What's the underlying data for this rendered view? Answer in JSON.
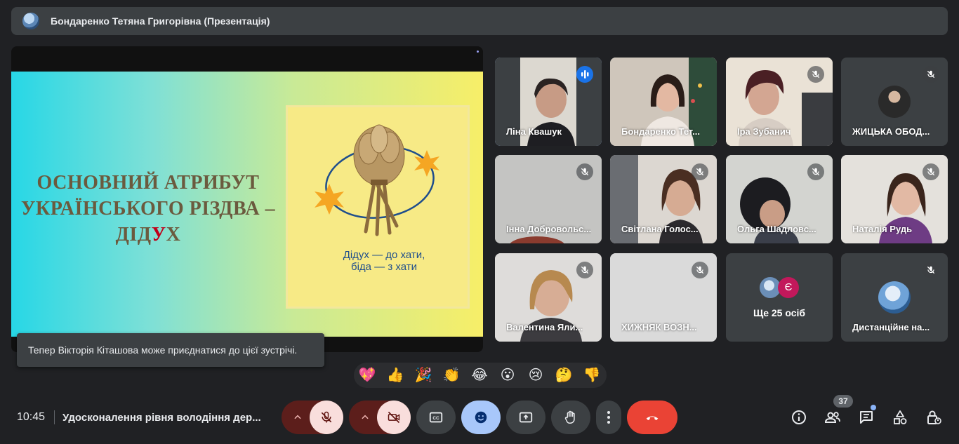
{
  "header": {
    "presenter_title": "Бондаренко Тетяна Григорівна (Презентація)"
  },
  "slide": {
    "heading_line1": "ОСНОВНИЙ АТРИБУТ",
    "heading_line2": "УКРАЇНСЬКОГО РІЗДВА –",
    "heading_line3_a": "ДІД",
    "heading_line3_b": "У",
    "heading_line3_c": "Х",
    "quote_line1": "Дідух — до хати,",
    "quote_line2": "біда — з хати"
  },
  "toast": {
    "message": "Тепер Вікторія Кіташова може приєднатися до цієї зустрічі."
  },
  "participants": [
    {
      "name": "Ліна Квашук",
      "state": "speaking"
    },
    {
      "name": "Бондаренко Тет...",
      "state": "video"
    },
    {
      "name": "Іра Зубанич",
      "state": "muted"
    },
    {
      "name": "ЖИЦЬКА ОБОД...",
      "state": "muted"
    },
    {
      "name": "Інна Добровольс...",
      "state": "muted"
    },
    {
      "name": "Світлана Голос...",
      "state": "muted"
    },
    {
      "name": "Ольга Шадловс...",
      "state": "muted"
    },
    {
      "name": "Наталія Рудь",
      "state": "muted"
    },
    {
      "name": "Валентина Яли...",
      "state": "muted"
    },
    {
      "name": "ХИЖНЯК ВОЗН...",
      "state": "muted"
    },
    {
      "name": "Ще 25 осіб",
      "state": "more",
      "avatar_letter": "Є"
    },
    {
      "name": "Дистанційне на...",
      "state": "muted"
    }
  ],
  "reactions": [
    "💖",
    "👍",
    "🎉",
    "👏",
    "😂",
    "😮",
    "😢",
    "🤔",
    "👎"
  ],
  "bottom": {
    "time": "10:45",
    "meeting_title": "Удосконалення рівня володіння дер...",
    "people_count": "37"
  },
  "colors": {
    "accent": "#8ab4f8",
    "end_call": "#ea4335",
    "muted_button": "#f9dedc",
    "reaction_button": "#a8c7fa"
  }
}
